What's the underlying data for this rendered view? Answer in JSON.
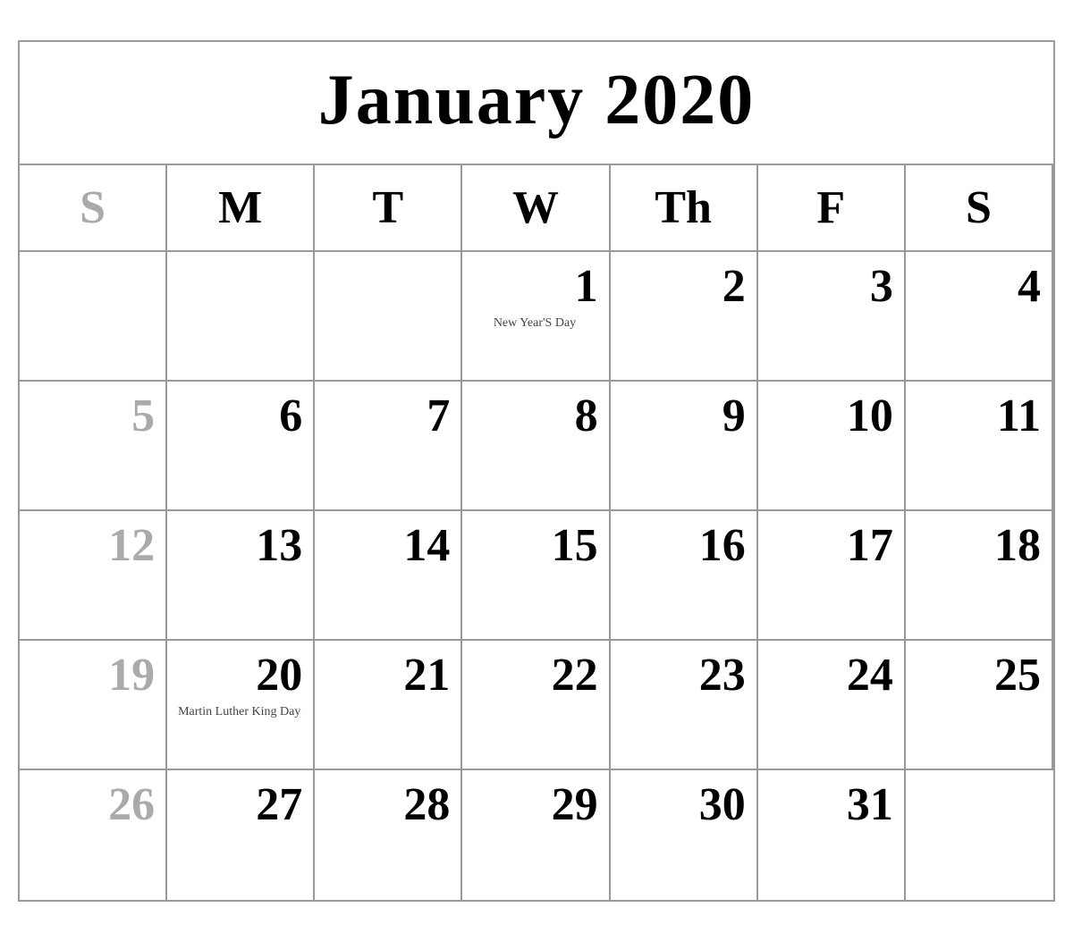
{
  "calendar": {
    "title": "January 2020",
    "headers": [
      {
        "label": "S",
        "type": "sunday"
      },
      {
        "label": "M",
        "type": "weekday"
      },
      {
        "label": "T",
        "type": "weekday"
      },
      {
        "label": "W",
        "type": "weekday"
      },
      {
        "label": "Th",
        "type": "weekday"
      },
      {
        "label": "F",
        "type": "weekday"
      },
      {
        "label": "S",
        "type": "weekday"
      }
    ],
    "weeks": [
      [
        {
          "day": "",
          "style": "empty"
        },
        {
          "day": "",
          "style": "empty"
        },
        {
          "day": "",
          "style": "empty"
        },
        {
          "day": "1",
          "style": "normal",
          "holiday": "New Year'S Day"
        },
        {
          "day": "2",
          "style": "normal"
        },
        {
          "day": "3",
          "style": "normal"
        },
        {
          "day": "4",
          "style": "normal"
        }
      ],
      [
        {
          "day": "5",
          "style": "sunday"
        },
        {
          "day": "6",
          "style": "normal"
        },
        {
          "day": "7",
          "style": "normal"
        },
        {
          "day": "8",
          "style": "normal"
        },
        {
          "day": "9",
          "style": "normal"
        },
        {
          "day": "10",
          "style": "normal"
        },
        {
          "day": "11",
          "style": "normal"
        }
      ],
      [
        {
          "day": "12",
          "style": "sunday"
        },
        {
          "day": "13",
          "style": "normal"
        },
        {
          "day": "14",
          "style": "normal"
        },
        {
          "day": "15",
          "style": "normal"
        },
        {
          "day": "16",
          "style": "normal"
        },
        {
          "day": "17",
          "style": "normal"
        },
        {
          "day": "18",
          "style": "normal"
        }
      ],
      [
        {
          "day": "19",
          "style": "sunday"
        },
        {
          "day": "20",
          "style": "normal",
          "holiday": "Martin Luther King Day"
        },
        {
          "day": "21",
          "style": "normal"
        },
        {
          "day": "22",
          "style": "normal"
        },
        {
          "day": "23",
          "style": "normal"
        },
        {
          "day": "24",
          "style": "normal"
        },
        {
          "day": "25",
          "style": "normal"
        }
      ],
      [
        {
          "day": "26",
          "style": "sunday"
        },
        {
          "day": "27",
          "style": "normal"
        },
        {
          "day": "28",
          "style": "normal"
        },
        {
          "day": "29",
          "style": "normal"
        },
        {
          "day": "30",
          "style": "normal"
        },
        {
          "day": "31",
          "style": "normal"
        },
        {
          "day": "",
          "style": "empty"
        }
      ]
    ]
  }
}
